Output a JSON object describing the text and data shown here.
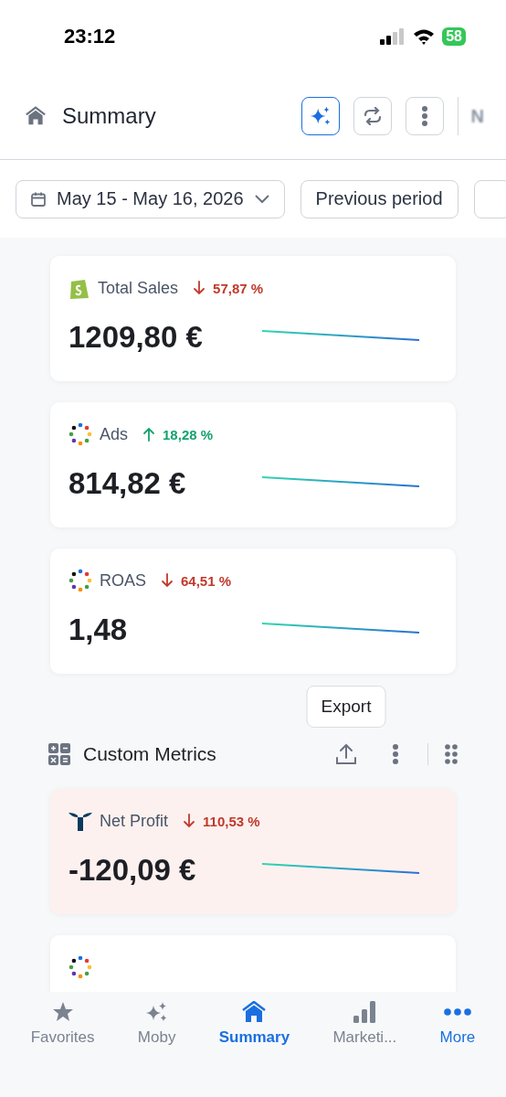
{
  "status_bar": {
    "time": "23:12",
    "battery": "58"
  },
  "header": {
    "title": "Summary",
    "avatar": "N",
    "ai_button_active": true
  },
  "filters": {
    "date_range": "May 15 - May 16, 2026",
    "compare": "Previous period"
  },
  "metrics": [
    {
      "kind": "shopify",
      "name": "Total Sales",
      "increase": false,
      "change": "57,87 %",
      "value": "1209,80 €",
      "alert": false
    },
    {
      "kind": "dots",
      "name": "Ads",
      "increase": true,
      "change": "18,28 %",
      "value": "814,82 €",
      "alert": false
    },
    {
      "kind": "dots",
      "name": "ROAS",
      "increase": false,
      "change": "64,51 %",
      "value": "1,48",
      "alert": false
    }
  ],
  "section": {
    "title": "Custom Metrics",
    "tooltip": "Export"
  },
  "custom_metrics": [
    {
      "kind": "triton",
      "name": "Net Profit",
      "increase": false,
      "change": "110,53 %",
      "value": "-120,09 €",
      "alert": true
    },
    {
      "kind": "dots",
      "alert": false
    }
  ],
  "tabs": [
    {
      "kind": "star",
      "label": "Favorites",
      "selected": false
    },
    {
      "kind": "sparkles",
      "label": "Moby",
      "selected": false
    },
    {
      "kind": "home",
      "label": "Summary",
      "selected": true
    },
    {
      "kind": "bars",
      "label": "Marketi...",
      "selected": false
    },
    {
      "kind": "more",
      "label": "More",
      "selected": false
    }
  ]
}
